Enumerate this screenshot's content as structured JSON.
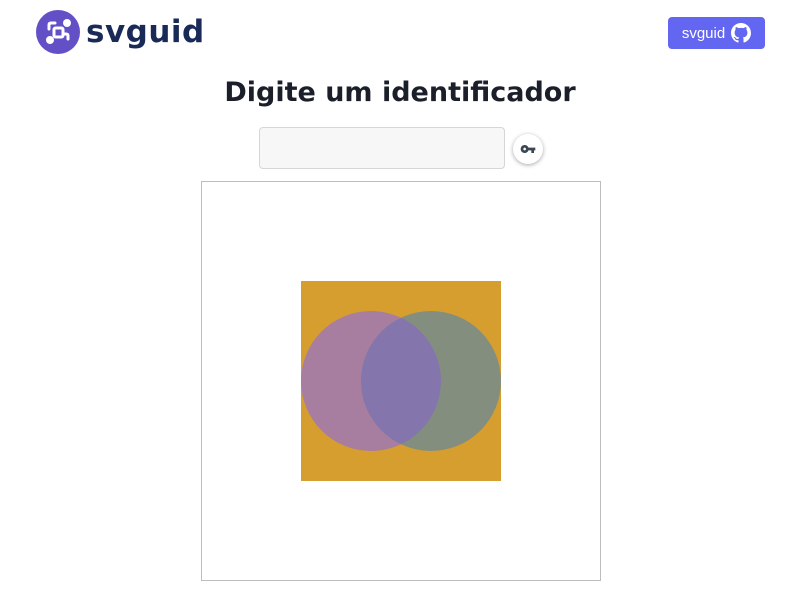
{
  "header": {
    "logo_text": "svguid",
    "logo_icon": "svguid-logo-icon",
    "github_button": {
      "label": "svguid",
      "icon": "github-icon",
      "color": "#6366f1"
    }
  },
  "main": {
    "title": "Digite um identificador",
    "input": {
      "value": "",
      "placeholder": ""
    },
    "generate_button": {
      "icon": "key-icon"
    },
    "generated_image": {
      "background_color": "#d59e2f",
      "left_circle_color": "#a77ea0",
      "right_circle_color": "#838e7f",
      "overlap_color": "#8475ad"
    }
  },
  "colors": {
    "brand_dark": "#1a2a57",
    "brand_purple": "#6350c7",
    "accent": "#6366f1"
  }
}
